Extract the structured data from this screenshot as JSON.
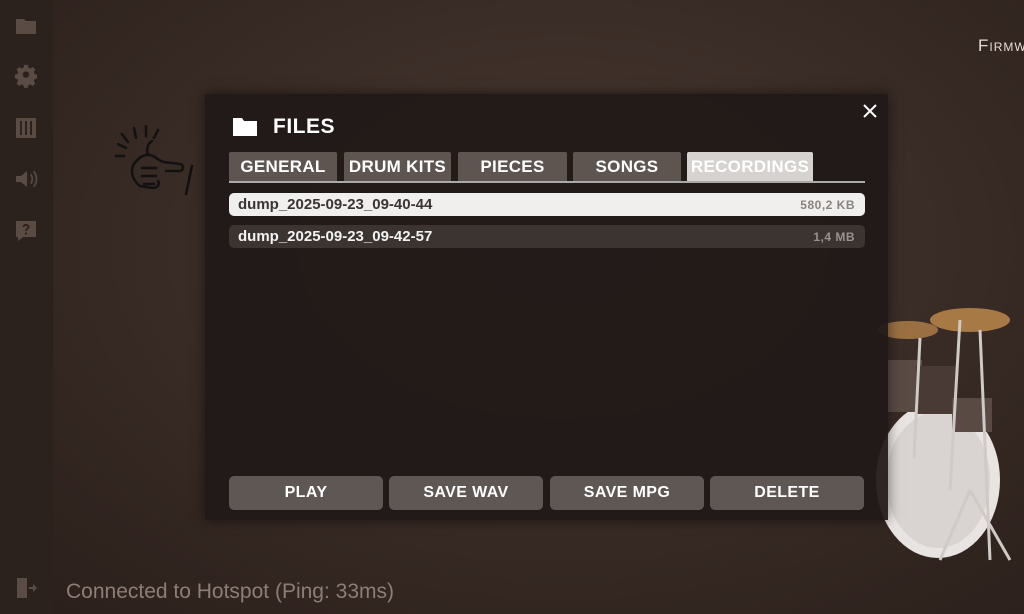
{
  "header": {
    "firmware_label": "Firmw"
  },
  "sidebar": {
    "items": [
      {
        "icon": "folder-icon"
      },
      {
        "icon": "gear-icon"
      },
      {
        "icon": "mixer-icon"
      },
      {
        "icon": "speaker-icon"
      },
      {
        "icon": "help-icon"
      },
      {
        "icon": "exit-icon"
      }
    ]
  },
  "status": {
    "text": "Connected to Hotspot  (Ping: 33ms)"
  },
  "modal": {
    "title": "FILES",
    "title_icon": "folder-icon",
    "close_icon": "close-icon",
    "tabs": [
      {
        "label": "GENERAL",
        "active": false
      },
      {
        "label": "DRUM KITS",
        "active": false
      },
      {
        "label": "PIECES",
        "active": false
      },
      {
        "label": "SONGS",
        "active": false
      },
      {
        "label": "RECORDINGS",
        "active": true
      }
    ],
    "files": [
      {
        "name": "dump_2025-09-23_09-40-44",
        "size": "580,2 KB",
        "selected": true
      },
      {
        "name": "dump_2025-09-23_09-42-57",
        "size": "1,4 MB",
        "selected": false
      }
    ],
    "actions": {
      "play": "PLAY",
      "save_wav": "SAVE WAV",
      "save_mpg": "SAVE MPG",
      "delete": "DELETE"
    }
  },
  "colors": {
    "modal_bg": "#211a17",
    "tab_bg": "#5e5551",
    "tab_active_bg": "#d6d2cf",
    "row_selected_bg": "#f0efee",
    "button_bg": "#5e5754"
  }
}
